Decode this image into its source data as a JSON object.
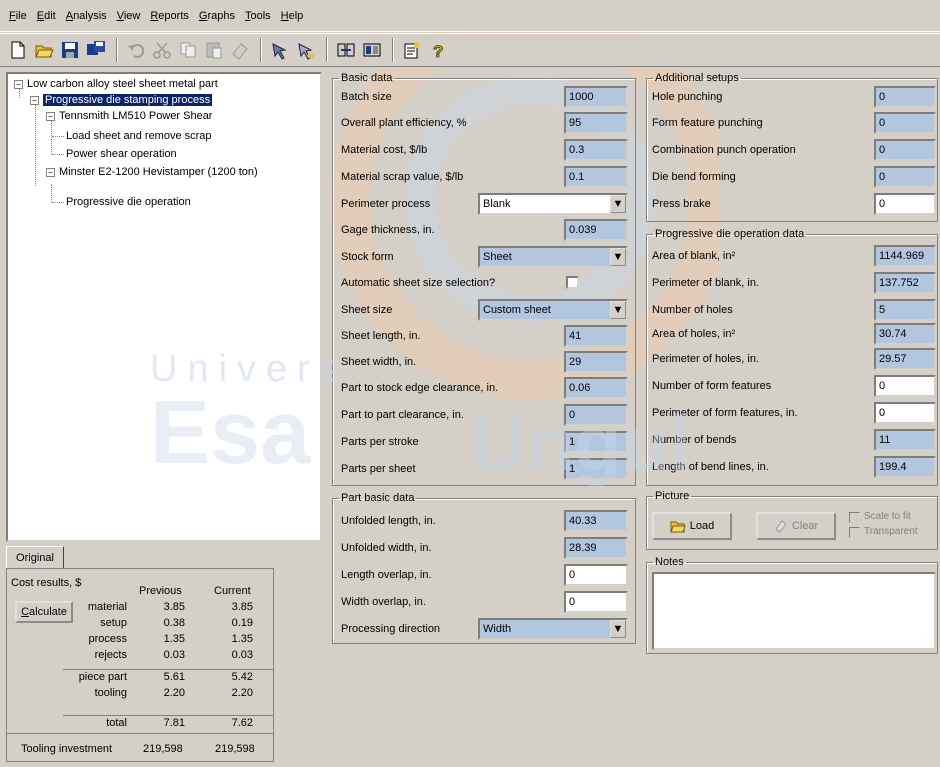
{
  "menu": [
    {
      "pre": "",
      "ul": "F",
      "post": "ile"
    },
    {
      "pre": "",
      "ul": "E",
      "post": "dit"
    },
    {
      "pre": "",
      "ul": "A",
      "post": "nalysis"
    },
    {
      "pre": "",
      "ul": "V",
      "post": "iew"
    },
    {
      "pre": "",
      "ul": "R",
      "post": "eports"
    },
    {
      "pre": "",
      "ul": "G",
      "post": "raphs"
    },
    {
      "pre": "",
      "ul": "T",
      "post": "ools"
    },
    {
      "pre": "",
      "ul": "H",
      "post": "elp"
    }
  ],
  "tree": {
    "root": "Low carbon alloy steel sheet metal part",
    "process": "Progressive die stamping process",
    "machine1": "Tennsmith LM510 Power Shear",
    "op1": "Load sheet and remove scrap",
    "op2": "Power shear operation",
    "machine2": "Minster E2-1200 Hevistamper (1200 ton)",
    "op3": "Progressive die operation"
  },
  "tab_original": "Original",
  "cost": {
    "title": "Cost results, $",
    "col_previous": "Previous",
    "col_current": "Current",
    "calculate": "Calculate",
    "rows": [
      {
        "label": "material",
        "previous": "3.85",
        "current": "3.85"
      },
      {
        "label": "setup",
        "previous": "0.38",
        "current": "0.19"
      },
      {
        "label": "process",
        "previous": "1.35",
        "current": "1.35"
      },
      {
        "label": "rejects",
        "previous": "0.03",
        "current": "0.03"
      },
      {
        "label": "piece part",
        "previous": "5.61",
        "current": "5.42"
      },
      {
        "label": "tooling",
        "previous": "2.20",
        "current": "2.20"
      },
      {
        "label": "total",
        "previous": "7.81",
        "current": "7.62"
      }
    ],
    "investment_label": "Tooling investment",
    "investment_previous": "219,598",
    "investment_current": "219,598"
  },
  "basic": {
    "legend": "Basic data",
    "batch_size_label": "Batch size",
    "batch_size": "1000",
    "efficiency_label": "Overall plant efficiency, %",
    "efficiency": "95",
    "material_cost_label": "Material cost, $/lb",
    "material_cost": "0.3",
    "scrap_value_label": "Material scrap value, $/lb",
    "scrap_value": "0.1",
    "perimeter_process_label": "Perimeter process",
    "perimeter_process": "Blank",
    "gage_label": "Gage thickness, in.",
    "gage": "0.039",
    "stock_form_label": "Stock form",
    "stock_form": "Sheet",
    "auto_sheet_label": "Automatic sheet size selection?",
    "sheet_size_label": "Sheet size",
    "sheet_size": "Custom sheet",
    "sheet_length_label": "Sheet length, in.",
    "sheet_length": "41",
    "sheet_width_label": "Sheet width, in.",
    "sheet_width": "29",
    "edge_clear_label": "Part to stock edge clearance, in.",
    "edge_clear": "0.06",
    "part_clear_label": "Part to part clearance, in.",
    "part_clear": "0",
    "parts_stroke_label": "Parts per stroke",
    "parts_stroke": "1",
    "parts_sheet_label": "Parts per sheet",
    "parts_sheet": "1"
  },
  "part": {
    "legend": "Part basic data",
    "unf_length_label": "Unfolded length, in.",
    "unf_length": "40.33",
    "unf_width_label": "Unfolded width, in.",
    "unf_width": "28.39",
    "len_overlap_label": "Length overlap, in.",
    "len_overlap": "0",
    "wid_overlap_label": "Width overlap, in.",
    "wid_overlap": "0",
    "direction_label": "Processing direction",
    "direction": "Width"
  },
  "additional": {
    "legend": "Additional setups",
    "hole_label": "Hole punching",
    "hole": "0",
    "form_label": "Form feature punching",
    "form": "0",
    "combo_label": "Combination punch operation",
    "combo": "0",
    "die_bend_label": "Die bend forming",
    "die_bend": "0",
    "press_brake_label": "Press brake",
    "press_brake": "0"
  },
  "prog": {
    "legend": "Progressive die operation data",
    "area_blank_label": "Area of blank, in²",
    "area_blank": "1144.969",
    "perim_blank_label": "Perimeter of blank, in.",
    "perim_blank": "137.752",
    "holes_label": "Number of holes",
    "holes": "5",
    "area_holes_label": "Area of holes, in²",
    "area_holes": "30.74",
    "perim_holes_label": "Perimeter of holes, in.",
    "perim_holes": "29.57",
    "form_feat_label": "Number of form features",
    "form_feat": "0",
    "perim_form_label": "Perimeter of form features, in.",
    "perim_form": "0",
    "bends_label": "Number of bends",
    "bends": "11",
    "bend_len_label": "Length of bend lines, in.",
    "bend_len": "199.4"
  },
  "picture": {
    "legend": "Picture",
    "load": "Load",
    "clear": "Clear",
    "scale_to_fit": "Scale to fit",
    "transparent": "Transparent"
  },
  "notes": {
    "legend": "Notes"
  },
  "watermark": {
    "line1": "Univers",
    "line2": "Esa",
    "line3": "Ungul"
  },
  "colors": {
    "field_blue": "#b3c6e0",
    "selection": "#0a246a",
    "window": "#d4d0c8"
  }
}
